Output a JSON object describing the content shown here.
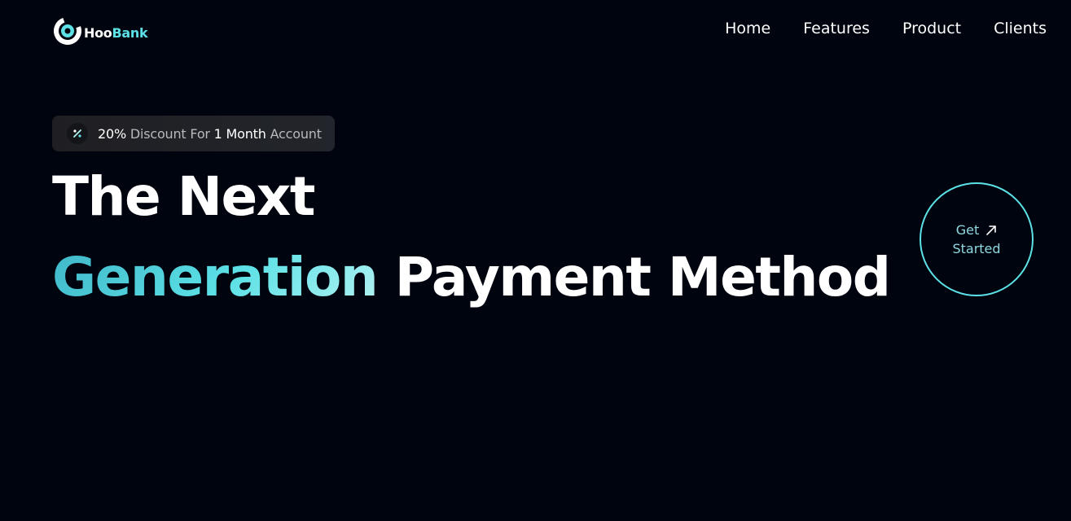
{
  "brand": {
    "name_part1": "Hoo",
    "name_part2": "Bank",
    "logo_icon": "hoobank-logo-icon",
    "accent_color": "#5ce1e6"
  },
  "nav": {
    "links": [
      "Home",
      "Features",
      "Product",
      "Clients"
    ]
  },
  "badge": {
    "icon": "discount-percent-icon",
    "percent": "20%",
    "text1": " Discount For ",
    "duration": "1 Month",
    "text2": " Account"
  },
  "hero": {
    "line1": "The Next",
    "line2_highlight": "Generation",
    "line2_rest": " Payment Method"
  },
  "cta": {
    "line1": "Get",
    "line2": "Started",
    "icon": "arrow-up-right-icon"
  },
  "background_text": {
    "items": [
      "",
      "",
      "",
      "",
      "",
      "",
      ""
    ]
  },
  "colors": {
    "background": "#00040f",
    "accent": "#5ce1e6",
    "badge_bg": "#1f1f23",
    "muted_text": "#b8b8bd"
  }
}
